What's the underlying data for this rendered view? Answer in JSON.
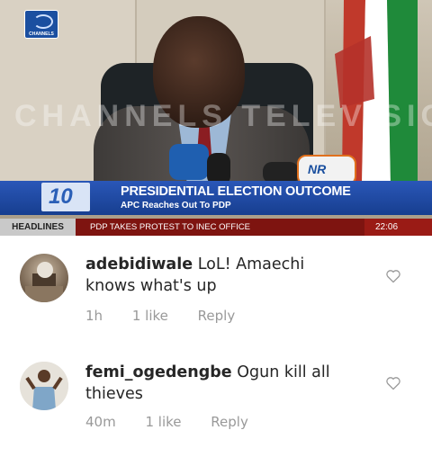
{
  "video": {
    "channel_logo_text": "CHANNELS",
    "watermark": "CHANNELS TELEVISION",
    "headline_title": "PRESIDENTIAL ELECTION OUTCOME",
    "headline_subtitle": "APC Reaches Out To PDP",
    "badge_number": "10",
    "ticker_label": "HEADLINES",
    "ticker_text": "PDP TAKES PROTEST TO INEC OFFICE",
    "ticker_time": "22:06",
    "mic_label": "NR"
  },
  "comments": [
    {
      "username": "adebidiwale",
      "text": "LoL! Amaechi knows what's up",
      "time": "1h",
      "likes": "1 like",
      "reply": "Reply"
    },
    {
      "username": "femi_ogedengbe",
      "text": "Ogun kill all thieves",
      "time": "40m",
      "likes": "1 like",
      "reply": "Reply"
    }
  ],
  "icons": [
    "channels-logo-icon",
    "heart-icon"
  ]
}
